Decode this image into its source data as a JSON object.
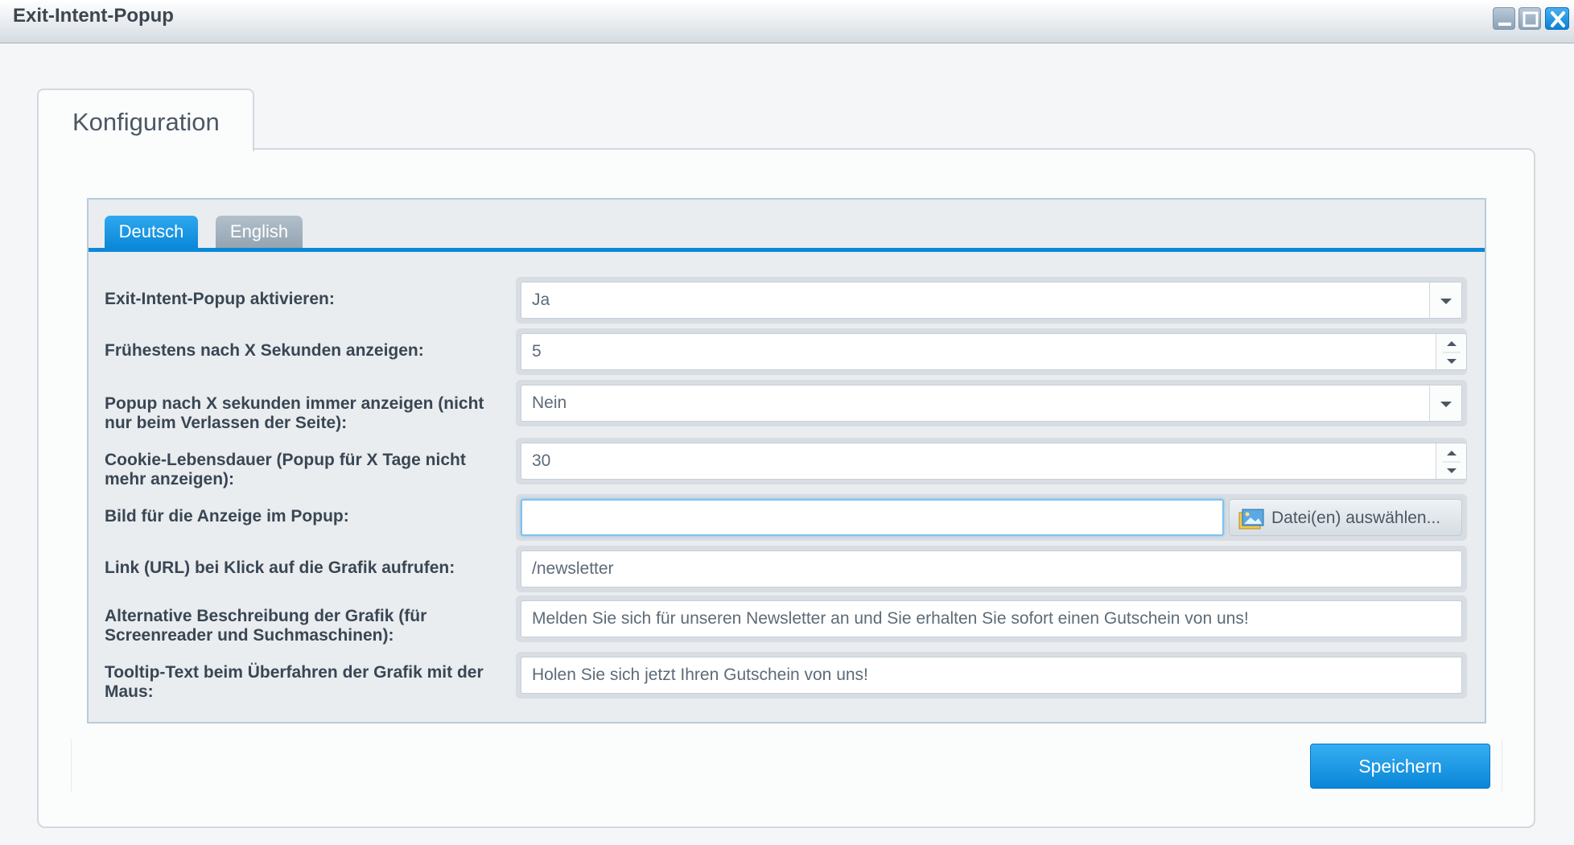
{
  "window": {
    "title": "Exit-Intent-Popup",
    "controls": [
      "minimize-icon",
      "maximize-icon",
      "close-icon"
    ]
  },
  "main_tab": {
    "label": "Konfiguration"
  },
  "language_tabs": [
    {
      "label": "Deutsch",
      "active": true
    },
    {
      "label": "English",
      "active": false
    }
  ],
  "form": {
    "rows": [
      {
        "label": "Exit-Intent-Popup aktivieren:",
        "type": "select",
        "value": "Ja"
      },
      {
        "label": "Frühestens nach X Sekunden anzeigen:",
        "type": "number",
        "value": "5"
      },
      {
        "label_line1": "Popup nach X sekunden immer anzeigen (nicht",
        "label_line2": "nur beim Verlassen der Seite):",
        "type": "select",
        "value": "Nein"
      },
      {
        "label_line1": "Cookie-Lebensdauer (Popup für X Tage nicht",
        "label_line2": "mehr anzeigen):",
        "type": "number",
        "value": "30"
      },
      {
        "label": "Bild für die Anzeige im Popup:",
        "type": "file",
        "value": "",
        "button_label": "Datei(en) auswählen..."
      },
      {
        "label": "Link (URL) bei Klick auf die Grafik aufrufen:",
        "type": "text",
        "value": "/newsletter"
      },
      {
        "label_line1": "Alternative Beschreibung der Grafik (für",
        "label_line2": "Screenreader und Suchmaschinen):",
        "type": "text",
        "value": "Melden Sie sich für unseren Newsletter an und Sie erhalten Sie sofort einen Gutschein von uns!"
      },
      {
        "label_line1": "Tooltip-Text beim Überfahren der Grafik mit der",
        "label_line2": "Maus:",
        "type": "text",
        "value": "Holen Sie sich jetzt Ihren Gutschein von uns!"
      }
    ]
  },
  "actions": {
    "save_label": "Speichern"
  },
  "colors": {
    "accent": "#0b88d9",
    "inactive_tab": "#a3b1bc",
    "label_text": "#3a4653",
    "panel_border": "#b9cbd8"
  }
}
